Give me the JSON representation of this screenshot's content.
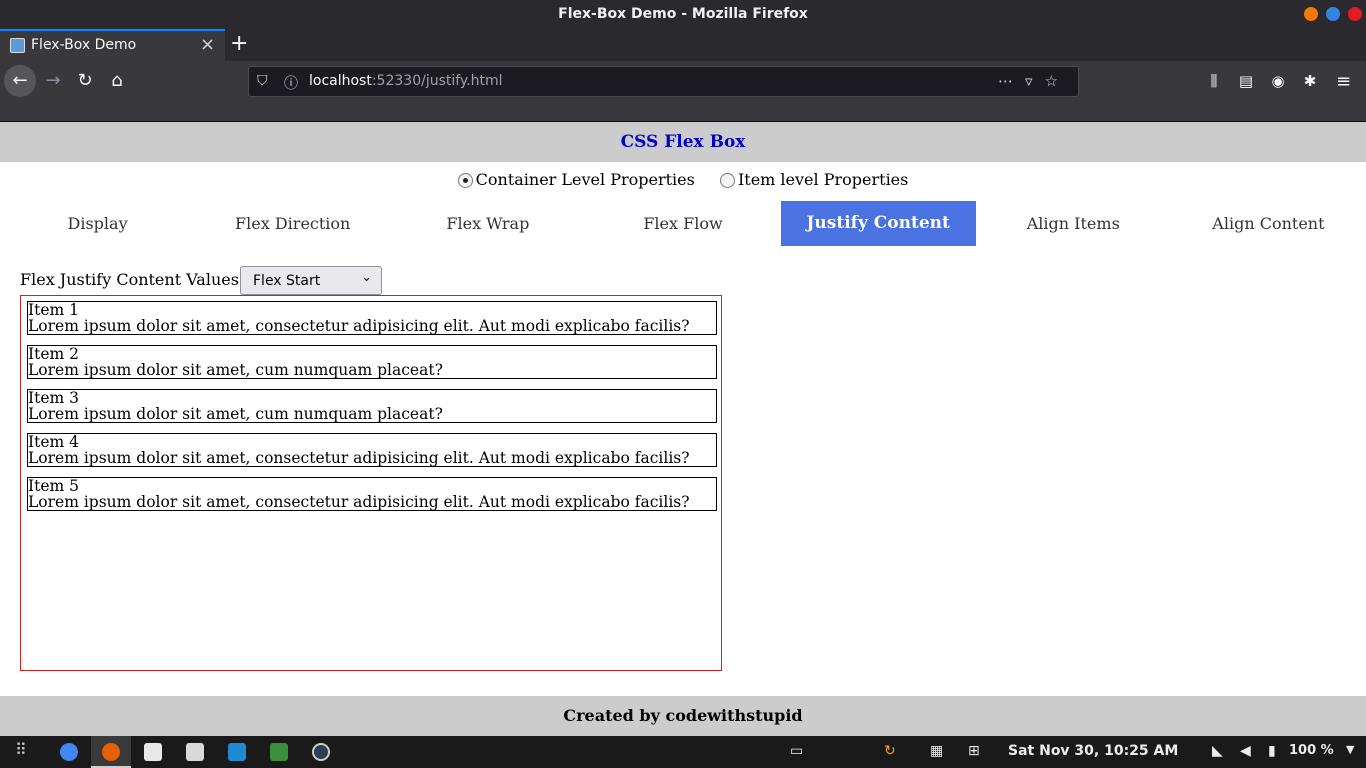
{
  "window": {
    "title": "Flex-Box Demo - Mozilla Firefox"
  },
  "browser": {
    "tab_title": "Flex-Box Demo",
    "url_host": "localhost",
    "url_rest": ":52330/justify.html"
  },
  "page": {
    "header_title": "CSS Flex Box",
    "radios": [
      {
        "label": "Container Level Properties",
        "checked": true
      },
      {
        "label": "Item level Properties",
        "checked": false
      }
    ],
    "nav_tabs": [
      "Display",
      "Flex Direction",
      "Flex Wrap",
      "Flex Flow",
      "Justify Content",
      "Align Items",
      "Align Content"
    ],
    "active_tab": "Justify Content",
    "control_label": "Flex Justify Content Values",
    "select_value": "Flex Start",
    "items": [
      {
        "title": "Item 1",
        "text": "Lorem ipsum dolor sit amet, consectetur adipisicing elit. Aut modi explicabo facilis?"
      },
      {
        "title": "Item 2",
        "text": "Lorem ipsum dolor sit amet, cum numquam placeat?"
      },
      {
        "title": "Item 3",
        "text": "Lorem ipsum dolor sit amet, cum numquam placeat?"
      },
      {
        "title": "Item 4",
        "text": "Lorem ipsum dolor sit amet, consectetur adipisicing elit. Aut modi explicabo facilis?"
      },
      {
        "title": "Item 5",
        "text": "Lorem ipsum dolor sit amet, consectetur adipisicing elit. Aut modi explicabo facilis?"
      }
    ],
    "footer": "Created by codewithstupid"
  },
  "taskbar": {
    "clock": "Sat Nov 30, 10:25 AM",
    "battery": "100 %"
  },
  "colors": {
    "header_bg": "#cccccc",
    "header_text": "#0000cc",
    "active_tab_bg": "#4a72e0",
    "container_border": "#cc2222"
  }
}
